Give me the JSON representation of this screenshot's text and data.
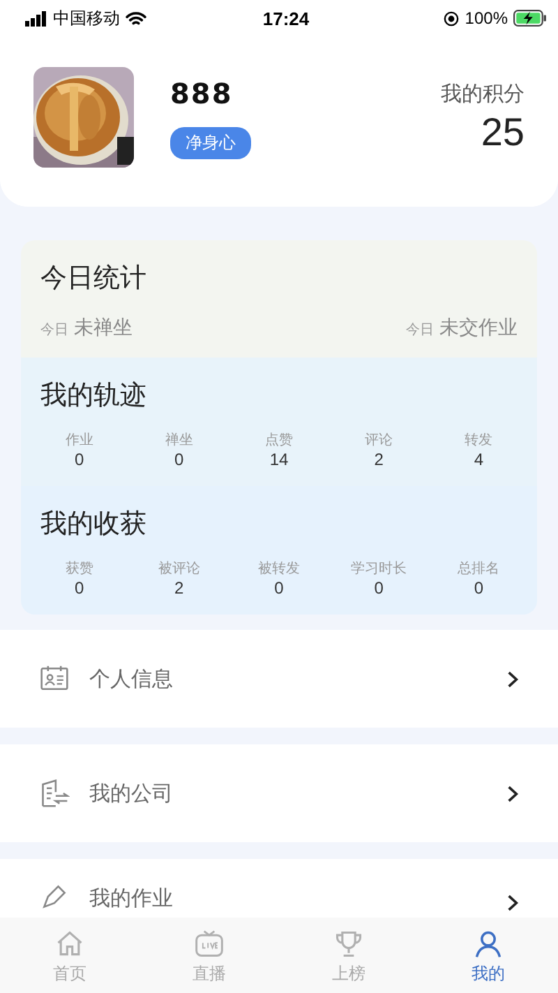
{
  "status_bar": {
    "carrier": "中国移动",
    "time": "17:24",
    "battery": "100%"
  },
  "profile": {
    "name": "888",
    "tag": "净身心",
    "points_label": "我的积分",
    "points": "25"
  },
  "today": {
    "title": "今日统计",
    "items": [
      {
        "prefix": "今日",
        "value": "未禅坐"
      },
      {
        "prefix": "今日",
        "value": "未交作业"
      }
    ]
  },
  "track": {
    "title": "我的轨迹",
    "stats": [
      {
        "label": "作业",
        "value": "0"
      },
      {
        "label": "禅坐",
        "value": "0"
      },
      {
        "label": "点赞",
        "value": "14"
      },
      {
        "label": "评论",
        "value": "2"
      },
      {
        "label": "转发",
        "value": "4"
      }
    ]
  },
  "harvest": {
    "title": "我的收获",
    "stats": [
      {
        "label": "获赞",
        "value": "0"
      },
      {
        "label": "被评论",
        "value": "2"
      },
      {
        "label": "被转发",
        "value": "0"
      },
      {
        "label": "学习时长",
        "value": "0"
      },
      {
        "label": "总排名",
        "value": "0"
      }
    ]
  },
  "menu": [
    {
      "label": "个人信息",
      "kind": "card"
    },
    {
      "label": "我的公司",
      "kind": "building"
    },
    {
      "label": "我的作业",
      "kind": "pen"
    }
  ],
  "tab_bar": [
    {
      "label": "首页",
      "kind": "home",
      "selected": false
    },
    {
      "label": "直播",
      "kind": "tv",
      "selected": false
    },
    {
      "label": "上榜",
      "kind": "trophy",
      "selected": false
    },
    {
      "label": "我的",
      "kind": "person",
      "selected": true
    }
  ]
}
